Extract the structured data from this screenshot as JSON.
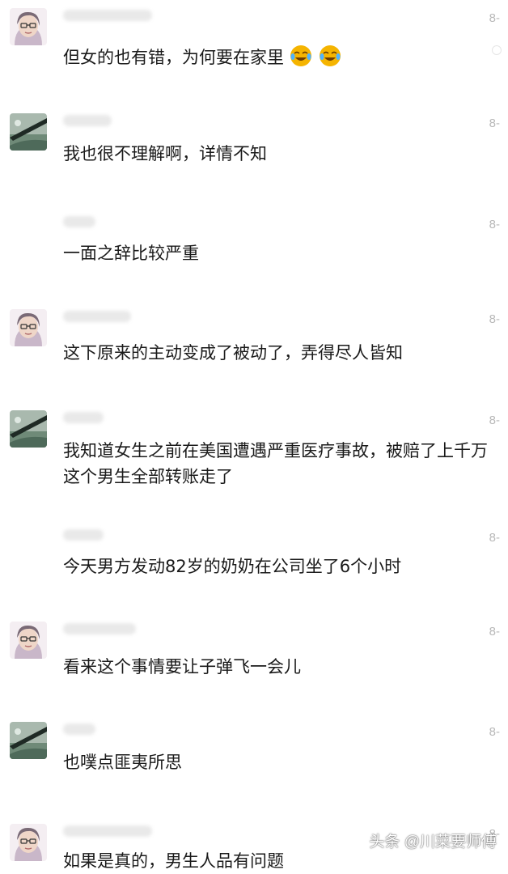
{
  "comments": [
    {
      "avatar": "woman-glasses-avatar",
      "time": "8-",
      "text": "但女的也有错，为何要在家里",
      "emojis": [
        "laugh-cry-emoji",
        "laugh-cry-emoji"
      ]
    },
    {
      "avatar": "landscape-avatar",
      "time": "8-",
      "text": "我也很不理解啊，详情不知",
      "emojis": []
    },
    {
      "avatar": "none",
      "time": "8-",
      "text": "一面之辞比较严重",
      "emojis": []
    },
    {
      "avatar": "woman-glasses-avatar",
      "time": "8-",
      "text": "这下原来的主动变成了被动了，弄得尽人皆知",
      "emojis": []
    },
    {
      "avatar": "landscape-avatar",
      "time": "8-",
      "text": "我知道女生之前在美国遭遇严重医疗事故，被赔了上千万\n这个男生全部转账走了",
      "emojis": []
    },
    {
      "avatar": "none",
      "time": "8-",
      "text": "今天男方发动82岁的奶奶在公司坐了6个小时",
      "emojis": []
    },
    {
      "avatar": "woman-glasses-avatar",
      "time": "8-",
      "text": "看来这个事情要让子弹飞一会儿",
      "emojis": []
    },
    {
      "avatar": "landscape-avatar",
      "time": "8-",
      "text": "也噗点匪夷所思",
      "emojis": []
    },
    {
      "avatar": "woman-glasses-avatar",
      "time": "8-",
      "text": "如果是真的，男生人品有问题",
      "emojis": []
    }
  ],
  "watermark": "头条 @川菜要师傅",
  "colors": {
    "text": "#1a1a1a",
    "time": "#b8b8b8",
    "emoji": "#f5b400"
  }
}
